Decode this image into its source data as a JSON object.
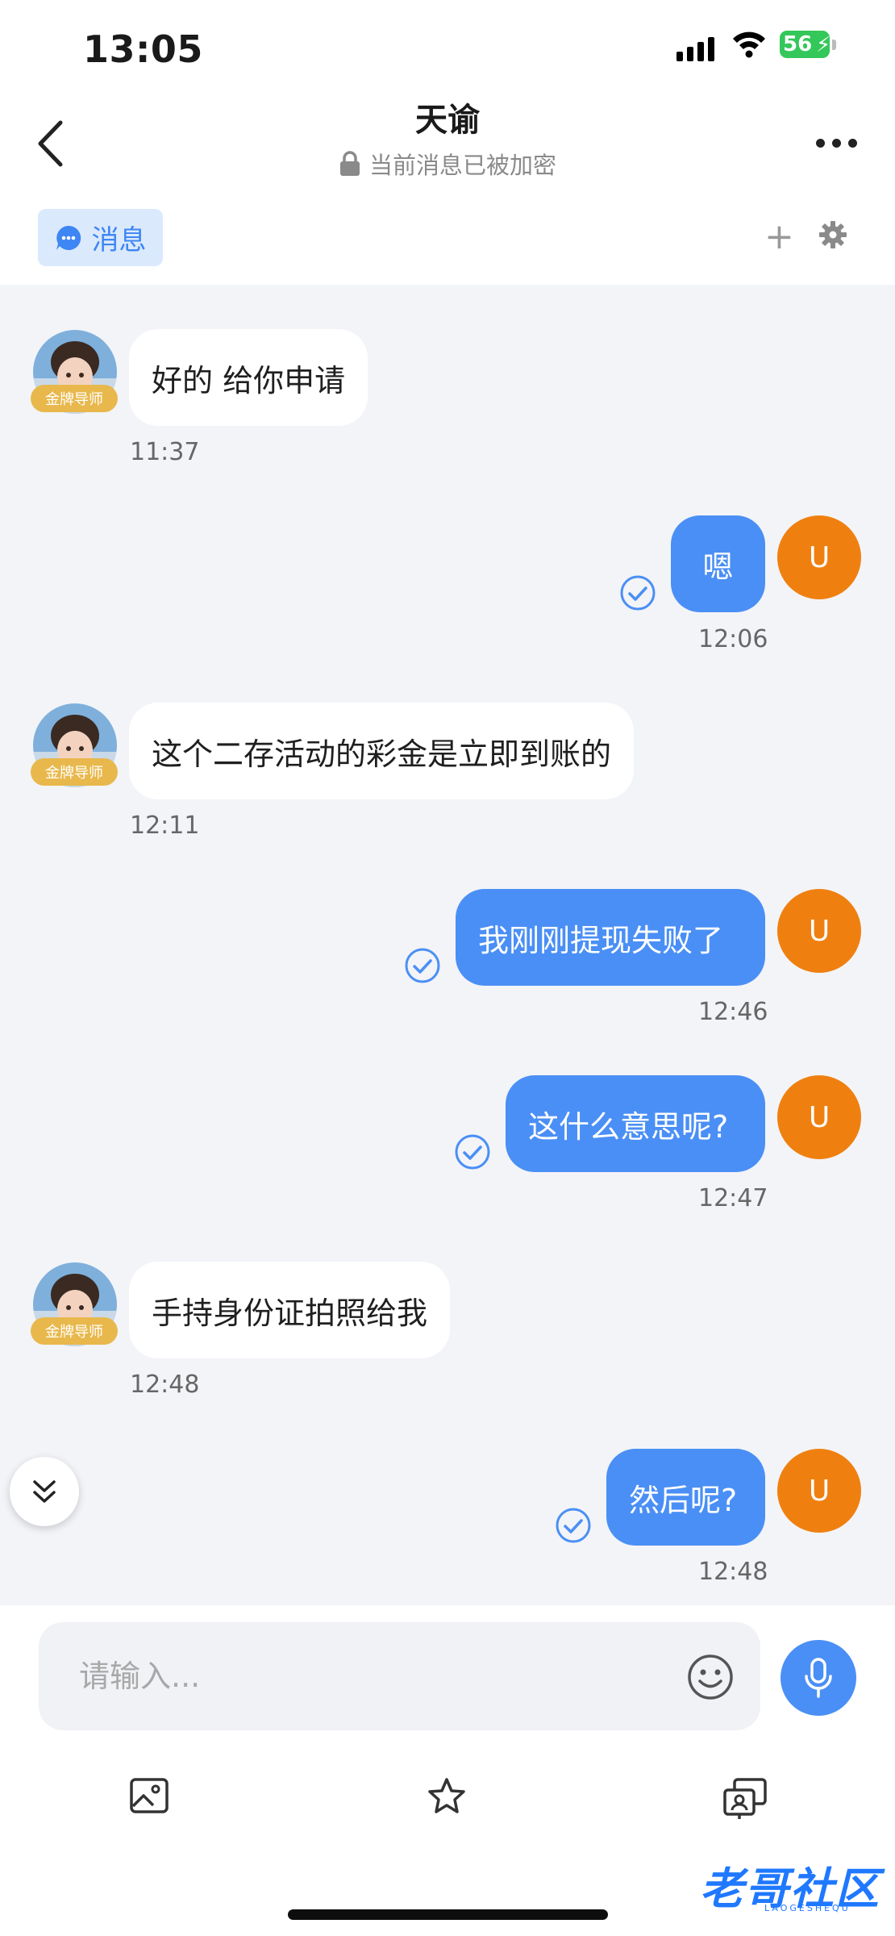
{
  "status_bar": {
    "time": "13:05",
    "battery": "56"
  },
  "header": {
    "title": "天谕",
    "subtitle": "当前消息已被加密"
  },
  "tabs": {
    "message_label": "消息"
  },
  "chat": {
    "badge_label": "金牌导师",
    "user_initial": "U",
    "messages": [
      {
        "from": "other",
        "text": "好的 给你申请",
        "time": "11:37"
      },
      {
        "from": "me",
        "text": "嗯",
        "time": "12:06"
      },
      {
        "from": "other",
        "text": "这个二存活动的彩金是立即到账的",
        "time": "12:11"
      },
      {
        "from": "me",
        "text": "我刚刚提现失败了",
        "time": "12:46"
      },
      {
        "from": "me",
        "text": "这什么意思呢?",
        "time": "12:47"
      },
      {
        "from": "other",
        "text": "手持身份证拍照给我",
        "time": "12:48"
      },
      {
        "from": "me",
        "text": "然后呢?",
        "time": "12:48"
      }
    ]
  },
  "composer": {
    "placeholder": "请输入..."
  },
  "watermark": {
    "text": "老哥社区",
    "sub": "LAOGESHEQU"
  }
}
